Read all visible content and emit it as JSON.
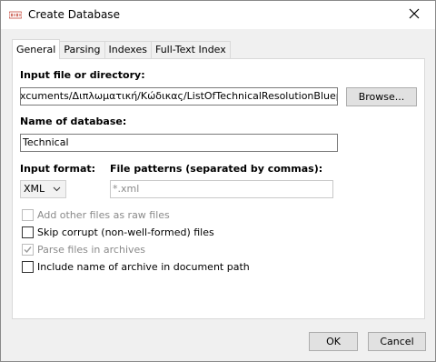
{
  "window": {
    "title": "Create Database",
    "app_icon_text": "BaseX"
  },
  "tabs": [
    {
      "label": "General",
      "active": true
    },
    {
      "label": "Parsing",
      "active": false
    },
    {
      "label": "Indexes",
      "active": false
    },
    {
      "label": "Full-Text Index",
      "active": false
    }
  ],
  "general": {
    "input_label": "Input file or directory:",
    "input_value": "xcuments/Διπλωματική/Κώδικας/ListOfTechnicalResolutionBlueprints.xml",
    "browse_label": "Browse...",
    "name_label": "Name of database:",
    "name_value": "Technical",
    "format_label": "Input format:",
    "format_value": "XML",
    "patterns_label": "File patterns (separated by commas):",
    "patterns_value": "*.xml",
    "options": [
      {
        "label": "Add other files as raw files",
        "checked": false,
        "enabled": false
      },
      {
        "label": "Skip corrupt (non-well-formed) files",
        "checked": false,
        "enabled": true
      },
      {
        "label": "Parse files in archives",
        "checked": true,
        "enabled": false
      },
      {
        "label": "Include name of archive in document path",
        "checked": false,
        "enabled": true
      }
    ]
  },
  "footer": {
    "ok_label": "OK",
    "cancel_label": "Cancel"
  },
  "colors": {
    "accent": "#0078d7",
    "disabled_text": "#8a8a8a"
  }
}
